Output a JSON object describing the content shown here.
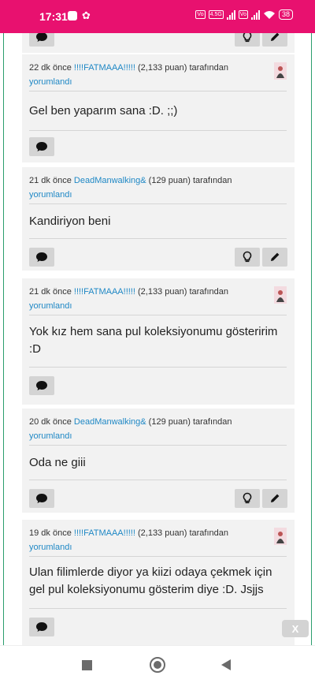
{
  "status": {
    "time": "17:31",
    "network_label": "4.5G",
    "battery": "38"
  },
  "comments": [
    {
      "meta_prefix": "22 dk önce",
      "username": "!!!!FATMAAA!!!!!",
      "points": "(2,133 puan)",
      "suffix": "tarafından",
      "action": "yorumlandı",
      "text": "Gel ben yaparım sana :D. ;;)"
    },
    {
      "meta_prefix": "21 dk önce",
      "username": "DeadManwalking&",
      "points": "(129 puan)",
      "suffix": "tarafından",
      "action": "yorumlandı",
      "text": "Kandiriyon beni"
    },
    {
      "meta_prefix": "21 dk önce",
      "username": "!!!!FATMAAA!!!!!",
      "points": "(2,133 puan)",
      "suffix": "tarafından",
      "action": "yorumlandı",
      "text": "Yok kız hem sana pul koleksiyonumu gösteririm :D"
    },
    {
      "meta_prefix": "20 dk önce",
      "username": "DeadManwalking&",
      "points": "(129 puan)",
      "suffix": "tarafından",
      "action": "yorumlandı",
      "text": "Oda ne giii"
    },
    {
      "meta_prefix": "19 dk önce",
      "username": "!!!!FATMAAA!!!!!",
      "points": "(2,133 puan)",
      "suffix": "tarafından",
      "action": "yorumlandı",
      "text": "Ulan filimlerde diyor ya kiizi odaya çekmek için gel pul koleksiyonumu gösterim diye :D. Jsjjs"
    }
  ],
  "overlay": {
    "close_label": "X"
  },
  "icons": {
    "reply": "speech-bubble-icon",
    "hint": "lightbulb-icon",
    "edit": "pencil-icon"
  },
  "colors": {
    "status_bar": "#e8116f",
    "link": "#1f88c5",
    "rail": "#2a9d6d"
  }
}
